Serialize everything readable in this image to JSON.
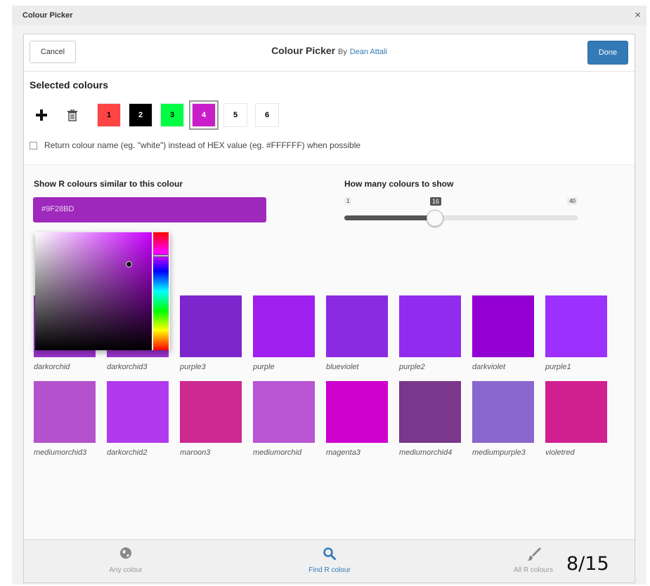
{
  "window": {
    "title": "Colour Picker",
    "close_label": "×"
  },
  "header": {
    "cancel_label": "Cancel",
    "title": "Colour Picker",
    "by": "By",
    "author": "Dean Attali",
    "done_label": "Done"
  },
  "selected": {
    "heading": "Selected colours",
    "add_icon": "plus-icon",
    "delete_icon": "trash-icon",
    "swatches": [
      {
        "label": "1",
        "color": "#ff4444",
        "text_color": "#000000"
      },
      {
        "label": "2",
        "color": "#000000",
        "text_color": "#ffffff"
      },
      {
        "label": "3",
        "color": "#00ff44",
        "text_color": "#000000"
      },
      {
        "label": "4",
        "color": "#c91ec9",
        "text_color": "#ffffff",
        "selected": true
      },
      {
        "label": "5",
        "color": "#ffffff",
        "text_color": "#000000"
      },
      {
        "label": "6",
        "color": "#ffffff",
        "text_color": "#000000"
      }
    ],
    "checkbox_label": "Return colour name (eg. \"white\") instead of HEX value (eg. #FFFFFF) when possible",
    "checkbox_checked": false
  },
  "find": {
    "similar_label": "Show R colours similar to this colour",
    "hex_value": "#9F28BD",
    "hex_color": "#9f28bd",
    "count_label": "How many colours to show",
    "slider": {
      "min": "1",
      "max": "40",
      "value": "16"
    }
  },
  "results": [
    {
      "name": "darkorchid",
      "color": "#9932cc"
    },
    {
      "name": "darkorchid3",
      "color": "#9a32cd"
    },
    {
      "name": "purple3",
      "color": "#7d26cd"
    },
    {
      "name": "purple",
      "color": "#a020f0"
    },
    {
      "name": "blueviolet",
      "color": "#8a2be2"
    },
    {
      "name": "purple2",
      "color": "#912cee"
    },
    {
      "name": "darkviolet",
      "color": "#9400d3"
    },
    {
      "name": "purple1",
      "color": "#9b30ff"
    },
    {
      "name": "mediumorchid3",
      "color": "#b452cd"
    },
    {
      "name": "darkorchid2",
      "color": "#b23aee"
    },
    {
      "name": "maroon3",
      "color": "#cd2990"
    },
    {
      "name": "mediumorchid",
      "color": "#ba55d3"
    },
    {
      "name": "magenta3",
      "color": "#cd00cd"
    },
    {
      "name": "mediumorchid4",
      "color": "#7a378b"
    },
    {
      "name": "mediumpurple3",
      "color": "#8968cd"
    },
    {
      "name": "violetred",
      "color": "#d02090"
    }
  ],
  "footer": {
    "tabs": [
      {
        "label": "Any colour",
        "icon": "globe-icon",
        "active": false
      },
      {
        "label": "Find R colour",
        "icon": "search-icon",
        "active": true
      },
      {
        "label": "All R colours",
        "icon": "brush-icon",
        "active": false
      }
    ]
  },
  "page_counter": "8/15",
  "colors": {
    "accent": "#337ab7",
    "inactive_tab": "#999999"
  }
}
